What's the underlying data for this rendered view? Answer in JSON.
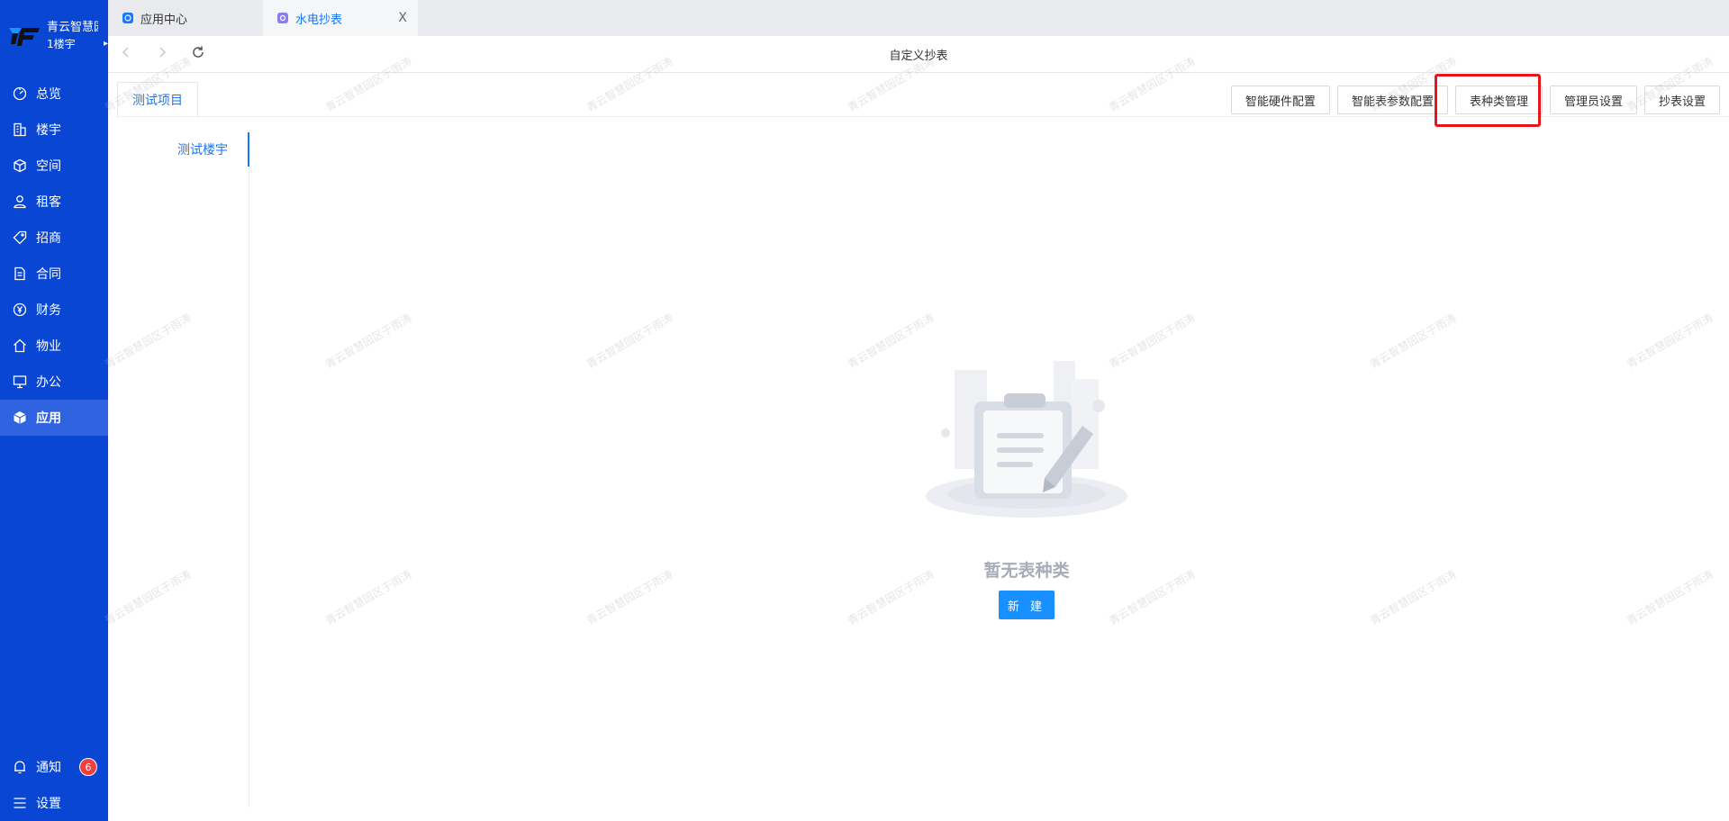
{
  "brand": {
    "name": "青云智慧园",
    "building": "1楼宇",
    "arrow": "▸"
  },
  "nav": {
    "items": [
      {
        "label": "总览",
        "icon": "dashboard-icon"
      },
      {
        "label": "楼宇",
        "icon": "building-icon"
      },
      {
        "label": "空间",
        "icon": "cube-icon"
      },
      {
        "label": "租客",
        "icon": "user-icon"
      },
      {
        "label": "招商",
        "icon": "tag-icon"
      },
      {
        "label": "合同",
        "icon": "document-icon"
      },
      {
        "label": "财务",
        "icon": "yuan-icon"
      },
      {
        "label": "物业",
        "icon": "home-icon"
      },
      {
        "label": "办公",
        "icon": "monitor-icon"
      },
      {
        "label": "应用",
        "icon": "app-icon",
        "active": true
      }
    ],
    "bottom": {
      "notify_label": "通知",
      "notify_count": "6",
      "settings_label": "设置"
    }
  },
  "tabs": [
    {
      "label": "应用中心",
      "active": false
    },
    {
      "label": "水电抄表",
      "active": true,
      "close": "X"
    }
  ],
  "toolbar": {
    "title": "自定义抄表"
  },
  "content": {
    "project_tab": "测试项目",
    "building_item": "测试楼宇",
    "buttons": {
      "hardware": "智能硬件配置",
      "params": "智能表参数配置",
      "meter_types": "表种类管理",
      "admins": "管理员设置",
      "reading": "抄表设置"
    },
    "empty_text": "暂无表种类",
    "new_button": "新 建",
    "watermark": "青云智慧园区于雨涛"
  },
  "colors": {
    "sidebar": "#0a46d4",
    "accent": "#1677ff",
    "highlight": "#e8161a",
    "badge": "#f04040"
  }
}
